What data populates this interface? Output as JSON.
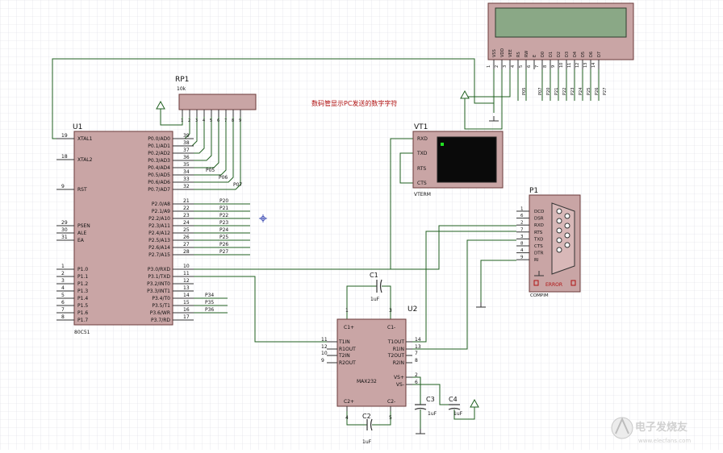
{
  "colors": {
    "grid": "#d9d9e0",
    "body": "#c9a5a5",
    "wire": "#1f5f1f",
    "pin": "#8b1a1a",
    "note": "#b01212",
    "text": "#111111",
    "screen": "#0a0a0a",
    "lcd": "#8aa886"
  },
  "note": "数码管显示PC发送的数字字符",
  "watermark": "电子发烧友",
  "watermark_url": "www.elecfans.com",
  "u1": {
    "ref": "U1",
    "part": "80C51",
    "left_pins": [
      {
        "num": "19",
        "name": "XTAL1"
      },
      {
        "num": "18",
        "name": "XTAL2"
      },
      {
        "num": "9",
        "name": "RST"
      },
      {
        "num": "29",
        "name": "PSEN"
      },
      {
        "num": "30",
        "name": "ALE"
      },
      {
        "num": "31",
        "name": "EA"
      },
      {
        "num": "1",
        "name": "P1.0"
      },
      {
        "num": "2",
        "name": "P1.1"
      },
      {
        "num": "3",
        "name": "P1.2"
      },
      {
        "num": "4",
        "name": "P1.3"
      },
      {
        "num": "5",
        "name": "P1.4"
      },
      {
        "num": "6",
        "name": "P1.5"
      },
      {
        "num": "7",
        "name": "P1.6"
      },
      {
        "num": "8",
        "name": "P1.7"
      }
    ],
    "right_pins": [
      {
        "num": "39",
        "name": "P0.0/AD0"
      },
      {
        "num": "38",
        "name": "P0.1/AD1"
      },
      {
        "num": "37",
        "name": "P0.2/AD2"
      },
      {
        "num": "36",
        "name": "P0.3/AD3"
      },
      {
        "num": "35",
        "name": "P0.4/AD4"
      },
      {
        "num": "34",
        "name": "P0.5/AD5"
      },
      {
        "num": "33",
        "name": "P0.6/AD6"
      },
      {
        "num": "32",
        "name": "P0.7/AD7"
      },
      {
        "num": "21",
        "name": "P2.0/A8"
      },
      {
        "num": "22",
        "name": "P2.1/A9"
      },
      {
        "num": "23",
        "name": "P2.2/A10"
      },
      {
        "num": "24",
        "name": "P2.3/A11"
      },
      {
        "num": "25",
        "name": "P2.4/A12"
      },
      {
        "num": "26",
        "name": "P2.5/A13"
      },
      {
        "num": "27",
        "name": "P2.6/A14"
      },
      {
        "num": "28",
        "name": "P2.7/A15"
      },
      {
        "num": "10",
        "name": "P3.0/RXD"
      },
      {
        "num": "11",
        "name": "P3.1/TXD"
      },
      {
        "num": "12",
        "name": "P3.2/INT0"
      },
      {
        "num": "13",
        "name": "P3.3/INT1"
      },
      {
        "num": "14",
        "name": "P3.4/T0"
      },
      {
        "num": "15",
        "name": "P3.5/T1"
      },
      {
        "num": "16",
        "name": "P3.6/WR"
      },
      {
        "num": "17",
        "name": "P3.7/RD"
      }
    ],
    "net_labels": [
      "P05",
      "P06",
      "P07",
      "P20",
      "P21",
      "P22",
      "P23",
      "P24",
      "P25",
      "P26",
      "P27",
      "P34",
      "P35",
      "P36"
    ]
  },
  "rp1": {
    "ref": "RP1",
    "value": "10k",
    "pins": [
      "1",
      "2",
      "3",
      "4",
      "5",
      "6",
      "7",
      "8",
      "9"
    ]
  },
  "lcd": {
    "pins": [
      {
        "num": "1",
        "name": "VSS"
      },
      {
        "num": "2",
        "name": "VDD"
      },
      {
        "num": "3",
        "name": "VEE"
      },
      {
        "num": "4",
        "name": "RS"
      },
      {
        "num": "5",
        "name": "RW"
      },
      {
        "num": "6",
        "name": "E"
      },
      {
        "num": "7",
        "name": "D0"
      },
      {
        "num": "8",
        "name": "D1"
      },
      {
        "num": "9",
        "name": "D2"
      },
      {
        "num": "10",
        "name": "D3"
      },
      {
        "num": "11",
        "name": "D4"
      },
      {
        "num": "12",
        "name": "D5"
      },
      {
        "num": "13",
        "name": "D6"
      },
      {
        "num": "14",
        "name": "D7"
      }
    ],
    "net_labels": [
      "P05",
      "P07",
      "P20",
      "P21",
      "P22",
      "P23",
      "P24",
      "P25",
      "P26",
      "P27"
    ]
  },
  "vt1": {
    "ref": "VT1",
    "footer": "VTERM",
    "pins": [
      "RXD",
      "TXD",
      "RTS",
      "CTS"
    ]
  },
  "p1": {
    "ref": "P1",
    "part": "COMPIM",
    "error": "ERROR",
    "pins": [
      {
        "num": "1",
        "name": "DCD"
      },
      {
        "num": "6",
        "name": "DSR"
      },
      {
        "num": "2",
        "name": "RXD"
      },
      {
        "num": "7",
        "name": "RTS"
      },
      {
        "num": "3",
        "name": "TXD"
      },
      {
        "num": "8",
        "name": "CTS"
      },
      {
        "num": "4",
        "name": "DTR"
      },
      {
        "num": "9",
        "name": "RI"
      }
    ]
  },
  "u2": {
    "ref": "U2",
    "part": "MAX232",
    "top_pins": [
      {
        "num": "1",
        "name": "C1+"
      },
      {
        "num": "3",
        "name": "C1-"
      }
    ],
    "bottom_pins": [
      {
        "num": "4",
        "name": "C2+"
      },
      {
        "num": "5",
        "name": "C2-"
      }
    ],
    "left_pins": [
      {
        "num": "11",
        "name": "T1IN"
      },
      {
        "num": "12",
        "name": "R1OUT"
      },
      {
        "num": "10",
        "name": "T2IN"
      },
      {
        "num": "9",
        "name": "R2OUT"
      }
    ],
    "right_pins": [
      {
        "num": "14",
        "name": "T1OUT"
      },
      {
        "num": "13",
        "name": "R1IN"
      },
      {
        "num": "7",
        "name": "T2OUT"
      },
      {
        "num": "8",
        "name": "R2IN"
      },
      {
        "num": "2",
        "name": "VS+"
      },
      {
        "num": "6",
        "name": "VS-"
      }
    ]
  },
  "caps": [
    {
      "ref": "C1",
      "value": "1uF"
    },
    {
      "ref": "C2",
      "value": "1uF"
    },
    {
      "ref": "C3",
      "value": "1uF"
    },
    {
      "ref": "C4",
      "value": "1uF"
    }
  ]
}
